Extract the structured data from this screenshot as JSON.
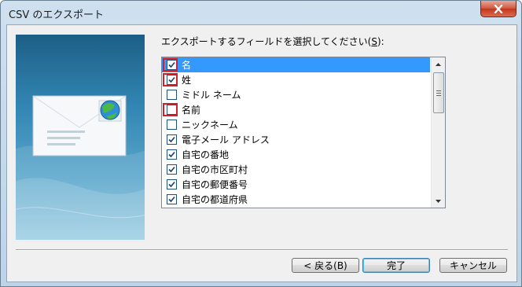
{
  "window": {
    "title": "CSV のエクスポート"
  },
  "instruction": {
    "text": "エクスポートするフィールドを選択してください(",
    "accel": "S",
    "suffix": "):"
  },
  "fields": [
    {
      "label": "名",
      "checked": true,
      "selected": true,
      "highlighted": true
    },
    {
      "label": "姓",
      "checked": true,
      "selected": false,
      "highlighted": true
    },
    {
      "label": "ミドル ネーム",
      "checked": false,
      "selected": false,
      "highlighted": false
    },
    {
      "label": "名前",
      "checked": false,
      "selected": false,
      "highlighted": true
    },
    {
      "label": "ニックネーム",
      "checked": false,
      "selected": false,
      "highlighted": false
    },
    {
      "label": "電子メール アドレス",
      "checked": true,
      "selected": false,
      "highlighted": false
    },
    {
      "label": "自宅の番地",
      "checked": true,
      "selected": false,
      "highlighted": false
    },
    {
      "label": "自宅の市区町村",
      "checked": true,
      "selected": false,
      "highlighted": false
    },
    {
      "label": "自宅の郵便番号",
      "checked": true,
      "selected": false,
      "highlighted": false
    },
    {
      "label": "自宅の都道府県",
      "checked": true,
      "selected": false,
      "highlighted": false
    }
  ],
  "buttons": {
    "back": "< 戻る(B)",
    "finish": "完了",
    "cancel": "キャンセル"
  },
  "colors": {
    "selection": "#3399ff",
    "highlight_box": "#d0202a"
  },
  "icons": [
    "close-icon",
    "envelope-icon",
    "globe-icon",
    "checkmark-icon",
    "scroll-up-icon",
    "scroll-down-icon"
  ]
}
